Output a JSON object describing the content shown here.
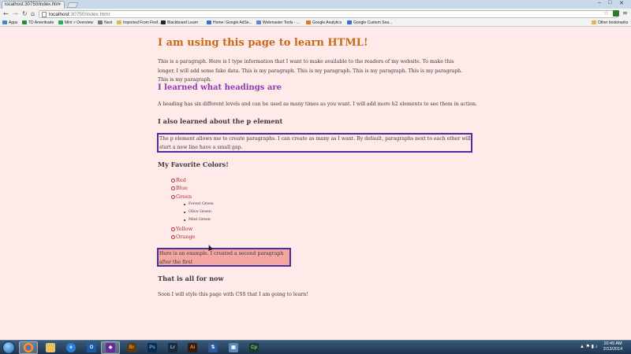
{
  "browser": {
    "tab_title": "localhost:30750/index.htm",
    "url_host": "localhost",
    "url_path": ":30750/index.html",
    "bookmarks": [
      {
        "label": "Apps",
        "color": "#4a80d0"
      },
      {
        "label": "TD Ameritrade",
        "color": "#2a8a3a"
      },
      {
        "label": "Mint > Overview",
        "color": "#2aaa5a"
      },
      {
        "label": "Nest",
        "color": "#777777"
      },
      {
        "label": "Imported From Firef...",
        "color": "#e0b84a"
      },
      {
        "label": "Blackboard Learn",
        "color": "#222222"
      },
      {
        "label": "Home: Google AdSe...",
        "color": "#3a70c8"
      },
      {
        "label": "Webmaster Tools - ...",
        "color": "#5a8ad0"
      },
      {
        "label": "Google Analytics",
        "color": "#e07a20"
      },
      {
        "label": "Google Custom Sea...",
        "color": "#3a70c8"
      }
    ],
    "other_bookmarks": "Other bookmarks"
  },
  "page": {
    "h1": "I am using this page to learn HTML!",
    "para1": "This is a paragraph. Here is I type information that I want to make available to the readers of my website. To make this longer, I will add some fake data. This is my paragraph. This is my paragraph. This is my paragraph. This is my paragraph. This is my paragraph.",
    "h2": "I learned what headings are",
    "para2": "A heading has six different levels and can be used as many times as you want. I will add more h2 elements to see them in action.",
    "h3_p": "I also learned about the p element",
    "boxed_para": "The p element allows me to create paragraphs. I can create as many as I want. By default, paragraphs next to each other will start a new line have a small gap.",
    "h3_colors": "My Favorite Colors!",
    "colors": {
      "red": "Red",
      "blue": "Blue",
      "green": "Green",
      "greens": [
        "Forest Green",
        "Olive Green",
        "Mint Green"
      ],
      "yellow": "Yellow",
      "orange": "Orange"
    },
    "example": "Here is an example. I created a second paragraph after the first",
    "h3_end": "That is all for now",
    "soon": "Soon I will style this page with CSS that I am going to learn!"
  },
  "taskbar": {
    "apps": [
      "Chrome",
      "Explorer",
      "IE",
      "Outlook",
      "Visual Studio",
      "Bridge",
      "Photoshop",
      "Lightroom",
      "Illustrator",
      "Network",
      "Remote",
      "Captivate"
    ],
    "time": "10:45 AM",
    "date": "2/13/2014"
  }
}
